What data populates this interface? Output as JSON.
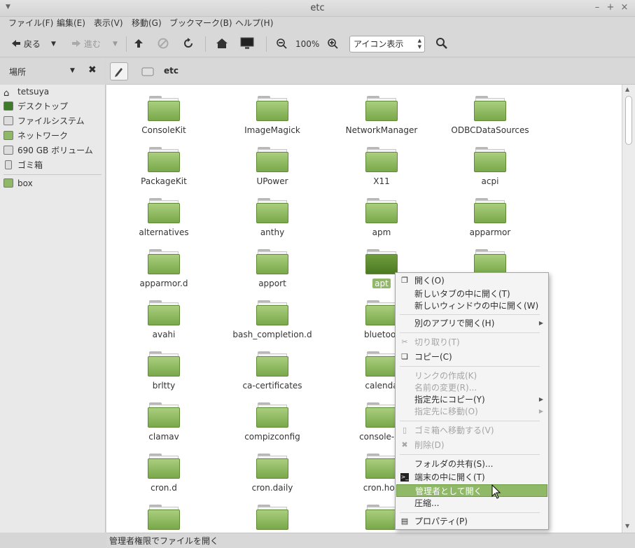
{
  "window": {
    "title": "etc"
  },
  "menubar": [
    "ファイル(F)",
    "編集(E)",
    "表示(V)",
    "移動(G)",
    "ブックマーク(B)",
    "ヘルプ(H)"
  ],
  "toolbar": {
    "back_label": "戻る",
    "forward_label": "進む",
    "zoom_level": "100%",
    "view_mode": "アイコン表示"
  },
  "sidebar": {
    "header": "場所",
    "items": [
      {
        "label": "tetsuya",
        "icon": "home-icon"
      },
      {
        "label": "デスクトップ",
        "icon": "desktop-icon"
      },
      {
        "label": "ファイルシステム",
        "icon": "drive-icon"
      },
      {
        "label": "ネットワーク",
        "icon": "network-icon"
      },
      {
        "label": "690 GB ボリューム",
        "icon": "drive-icon"
      },
      {
        "label": "ゴミ箱",
        "icon": "trash-icon"
      }
    ],
    "bookmarks": [
      {
        "label": "box",
        "icon": "folder-icon"
      }
    ]
  },
  "pathbar": {
    "current": "etc"
  },
  "folders": [
    [
      "ConsoleKit",
      "ImageMagick",
      "NetworkManager",
      "ODBCDataSources"
    ],
    [
      "PackageKit",
      "UPower",
      "X11",
      "acpi"
    ],
    [
      "alternatives",
      "anthy",
      "apm",
      "apparmor"
    ],
    [
      "apparmor.d",
      "apport",
      "apt",
      ""
    ],
    [
      "avahi",
      "bash_completion.d",
      "bluetoot",
      ""
    ],
    [
      "brltty",
      "ca-certificates",
      "calenda",
      ""
    ],
    [
      "clamav",
      "compizconfig",
      "console-se",
      ""
    ],
    [
      "cron.d",
      "cron.daily",
      "cron.hou",
      ""
    ]
  ],
  "selected_folder": "apt",
  "context_menu": {
    "items": [
      {
        "label": "開く(O)",
        "icon": "open-icon"
      },
      {
        "label": "新しいタブの中に開く(T)"
      },
      {
        "label": "新しいウィンドウの中に開く(W)"
      },
      {
        "label": "別のアプリで開く(H)"
      },
      {
        "label": "切り取り(T)",
        "icon": "cut-icon"
      },
      {
        "label": "コピー(C)",
        "icon": "copy-icon"
      },
      {
        "label": "リンクの作成(K)"
      },
      {
        "label": "名前の変更(R)..."
      },
      {
        "label": "指定先にコピー(Y)"
      },
      {
        "label": "指定先に移動(O)"
      },
      {
        "label": "ゴミ箱へ移動する(V)",
        "icon": "trash-icon"
      },
      {
        "label": "削除(D)",
        "icon": "delete-icon"
      },
      {
        "label": "フォルダの共有(S)..."
      },
      {
        "label": "端末の中に開く(T)",
        "icon": "terminal-icon"
      },
      {
        "label": "管理者として開く"
      },
      {
        "label": "圧縮..."
      },
      {
        "label": "プロパティ(P)",
        "icon": "properties-icon"
      }
    ]
  },
  "status": {
    "text": "管理者権限でファイルを開く"
  },
  "colors": {
    "folder": "#8fb867",
    "highlight": "#8fb867"
  }
}
